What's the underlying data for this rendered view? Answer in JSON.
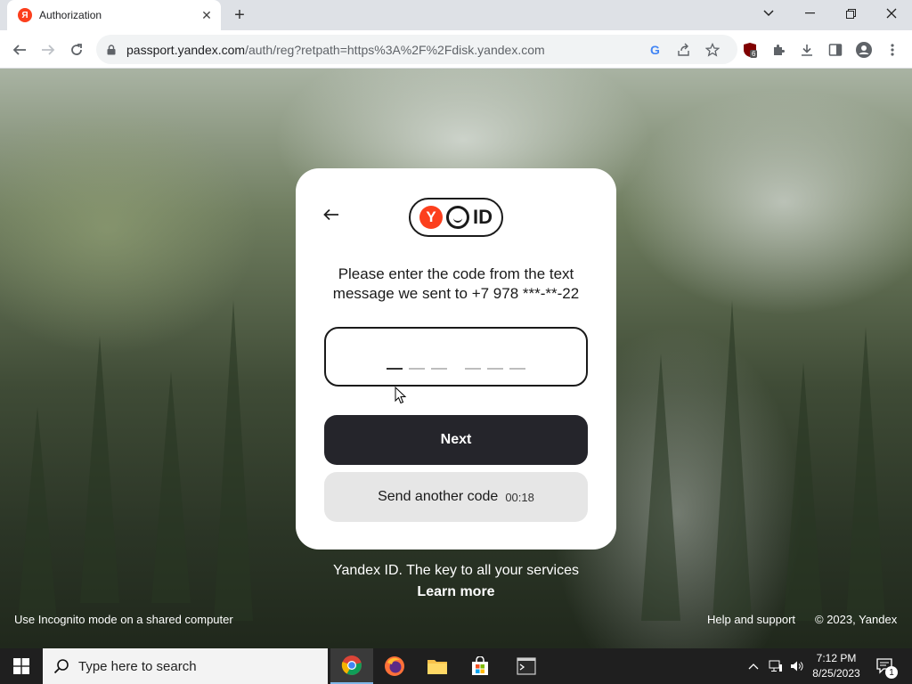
{
  "browser": {
    "tab_title": "Authorization",
    "favicon_letter": "Я",
    "url_host": "passport.yandex.com",
    "url_path": "/auth/reg?retpath=https%3A%2F%2Fdisk.yandex.com",
    "extension_badge": "6"
  },
  "card": {
    "logo_y": "Y",
    "logo_id": "ID",
    "instruction_line1": "Please enter the code from the text",
    "instruction_line2": "message we sent to +7 978 ***-**-22",
    "next_label": "Next",
    "resend_label": "Send another code",
    "resend_timer": "00:18"
  },
  "page": {
    "tagline": "Yandex ID. The key to all your services",
    "learn_more": "Learn more",
    "footer_left": "Use Incognito mode on a shared computer",
    "footer_help": "Help and support",
    "footer_copy": "© 2023, Yandex"
  },
  "taskbar": {
    "search_placeholder": "Type here to search",
    "time": "7:12 PM",
    "date": "8/25/2023",
    "notification_count": "1"
  },
  "icons": {
    "yandex_red": "#fc3f1d",
    "button_dark": "#25252b"
  }
}
